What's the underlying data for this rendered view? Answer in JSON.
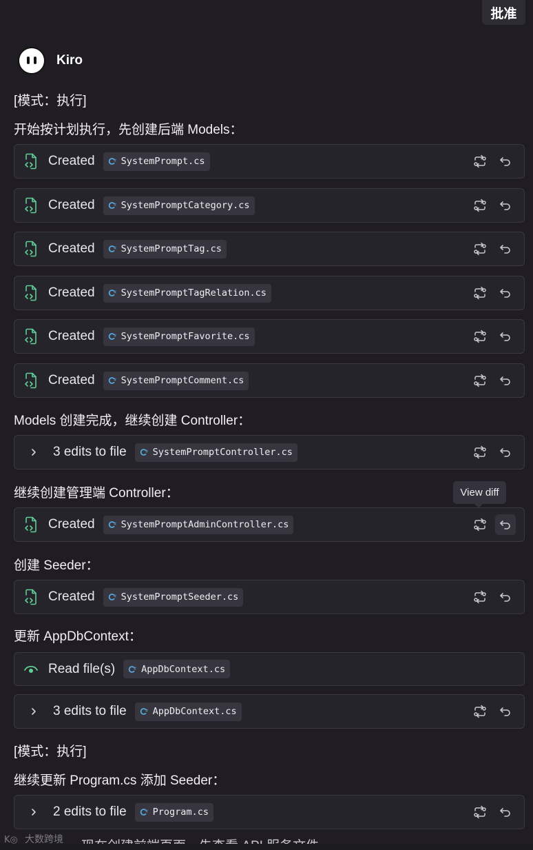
{
  "approve_button": "批准",
  "agent": {
    "name": "Kiro"
  },
  "texts": {
    "mode1": "[模式：执行]",
    "intro": "开始按计划执行，先创建后端 Models：",
    "models_done": "Models 创建完成，继续创建 Controller：",
    "admin_controller": "继续创建管理端 Controller：",
    "seeder": "创建 Seeder：",
    "update_ctx": "更新 AppDbContext：",
    "mode2": "[模式：执行]",
    "program": "继续更新 Program.cs 添加 Seeder：",
    "partial": "现在创建前端页面，先查看 API 服务文件"
  },
  "tooltip": "View diff",
  "cards": [
    {
      "type": "created",
      "status": "Created",
      "file": "SystemPrompt.cs"
    },
    {
      "type": "created",
      "status": "Created",
      "file": "SystemPromptCategory.cs"
    },
    {
      "type": "created",
      "status": "Created",
      "file": "SystemPromptTag.cs"
    },
    {
      "type": "created",
      "status": "Created",
      "file": "SystemPromptTagRelation.cs"
    },
    {
      "type": "created",
      "status": "Created",
      "file": "SystemPromptFavorite.cs"
    },
    {
      "type": "created",
      "status": "Created",
      "file": "SystemPromptComment.cs"
    },
    {
      "type": "edits",
      "status": "3 edits to file",
      "file": "SystemPromptController.cs"
    },
    {
      "type": "created",
      "status": "Created",
      "file": "SystemPromptAdminController.cs"
    },
    {
      "type": "created",
      "status": "Created",
      "file": "SystemPromptSeeder.cs"
    },
    {
      "type": "read",
      "status": "Read file(s)",
      "file": "AppDbContext.cs"
    },
    {
      "type": "edits",
      "status": "3 edits to file",
      "file": "AppDbContext.cs"
    },
    {
      "type": "edits",
      "status": "2 edits to file",
      "file": "Program.cs"
    }
  ],
  "watermark": "大数跨境",
  "colors": {
    "background": "#1f1d23",
    "card": "#26242b",
    "accent_green": "#5fcf96",
    "chip": "#37353d",
    "cs_blue": "#59a7e0"
  }
}
